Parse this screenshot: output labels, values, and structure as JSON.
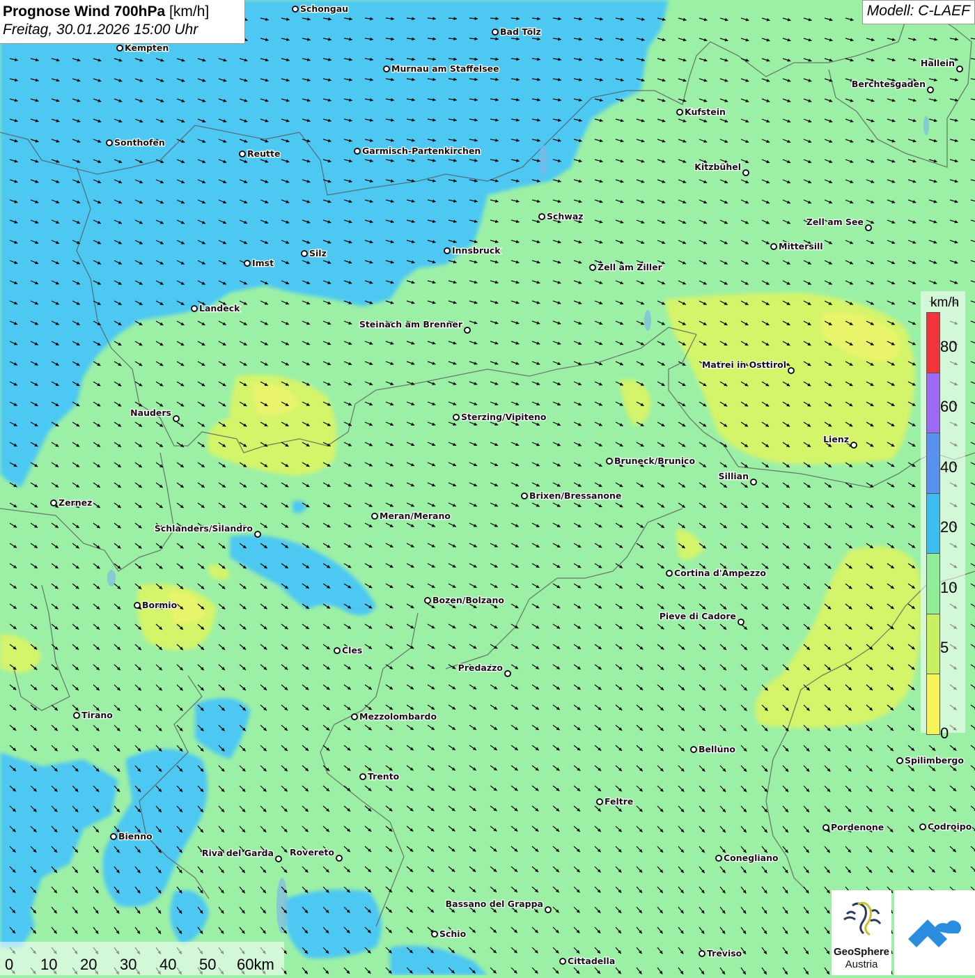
{
  "title": {
    "main": "Prognose Wind 700hPa",
    "unit": "[km/h]",
    "date": "Freitag, 30.01.2026 15:00 Uhr"
  },
  "model": "Modell: C-LAEF",
  "legend": {
    "unit": "km/h",
    "labels": [
      "80",
      "60",
      "40",
      "20",
      "10",
      "5",
      "0"
    ],
    "bands": [
      {
        "from": 80,
        "color": "#f0363a"
      },
      {
        "from": 60,
        "color": "#9a6af2"
      },
      {
        "from": 40,
        "color": "#5a90ee"
      },
      {
        "from": 20,
        "color": "#3cbfef"
      },
      {
        "from": 10,
        "color": "#90ee99"
      },
      {
        "from": 5,
        "color": "#c8f060"
      },
      {
        "from": 0,
        "color": "#f5f55a"
      }
    ]
  },
  "scalebar": {
    "labels": [
      "0",
      "10",
      "20",
      "30",
      "40",
      "50",
      "60km"
    ]
  },
  "logo": {
    "line1": "GeoSphere",
    "line2": "Austria"
  },
  "cities": [
    {
      "name": "Schongau"
    },
    {
      "name": "Bad Tölz"
    },
    {
      "name": "Kempten"
    },
    {
      "name": "Murnau am Staffelsee"
    },
    {
      "name": "Hallein"
    },
    {
      "name": "Berchtesgaden"
    },
    {
      "name": "Kufstein"
    },
    {
      "name": "Sonthofen"
    },
    {
      "name": "Reutte"
    },
    {
      "name": "Garmisch-Partenkirchen"
    },
    {
      "name": "Kitzbühel"
    },
    {
      "name": "Schwaz"
    },
    {
      "name": "Zell am See"
    },
    {
      "name": "Mittersill"
    },
    {
      "name": "Innsbruck"
    },
    {
      "name": "Silz"
    },
    {
      "name": "Imst"
    },
    {
      "name": "Zell am Ziller"
    },
    {
      "name": "Landeck"
    },
    {
      "name": "Steinach am Brenner"
    },
    {
      "name": "Matrei in Osttirol"
    },
    {
      "name": "Nauders"
    },
    {
      "name": "Sterzing/Vipiteno"
    },
    {
      "name": "Lienz"
    },
    {
      "name": "Bruneck/Brunico"
    },
    {
      "name": "Sillian"
    },
    {
      "name": "Zernez"
    },
    {
      "name": "Brixen/Bressanone"
    },
    {
      "name": "Meran/Merano"
    },
    {
      "name": "Schlanders/Silandro"
    },
    {
      "name": "Cortina d'Ampezzo"
    },
    {
      "name": "Bozen/Bolzano"
    },
    {
      "name": "Bormio"
    },
    {
      "name": "Pieve di Cadore"
    },
    {
      "name": "Cles"
    },
    {
      "name": "Predazzo"
    },
    {
      "name": "Tirano"
    },
    {
      "name": "Mezzolombardo"
    },
    {
      "name": "Belluno"
    },
    {
      "name": "Spilimbergo"
    },
    {
      "name": "Trento"
    },
    {
      "name": "Feltre"
    },
    {
      "name": "Pordenone"
    },
    {
      "name": "Codroipo"
    },
    {
      "name": "Bienno"
    },
    {
      "name": "Riva del Garda"
    },
    {
      "name": "Rovereto"
    },
    {
      "name": "Conegliano"
    },
    {
      "name": "Bassano del Grappa"
    },
    {
      "name": "Schio"
    },
    {
      "name": "Treviso"
    },
    {
      "name": "Cittadella"
    }
  ]
}
